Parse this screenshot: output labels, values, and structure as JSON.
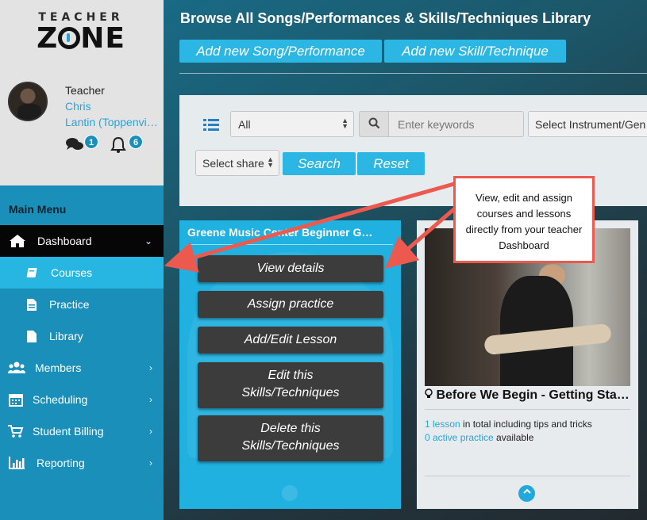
{
  "brand": {
    "logo_top": "TEACHER",
    "logo_main_left": "Z",
    "logo_main_right": "NE"
  },
  "user": {
    "role": "Teacher",
    "first_name": "Chris",
    "last_name": "Lantin (Toppenvi…"
  },
  "notifications": {
    "messages_count": "1",
    "alerts_count": "6"
  },
  "sidebar": {
    "heading": "Main Menu",
    "items": [
      {
        "label": "Dashboard",
        "icon": "home-icon",
        "chevron": "⌄"
      },
      {
        "label": "Courses",
        "icon": "book-icon"
      },
      {
        "label": "Practice",
        "icon": "document-icon"
      },
      {
        "label": "Library",
        "icon": "file-icon"
      },
      {
        "label": "Members",
        "icon": "users-icon",
        "chevron": "›"
      },
      {
        "label": "Scheduling",
        "icon": "calendar-icon",
        "chevron": "›"
      },
      {
        "label": "Student Billing",
        "icon": "cart-icon",
        "chevron": "›"
      },
      {
        "label": "Reporting",
        "icon": "bar-chart-icon",
        "chevron": "›"
      }
    ]
  },
  "header": {
    "title": "Browse All Songs/Performances & Skills/Techniques Library",
    "add_song_label": "Add new Song/Performance",
    "add_skill_label": "Add new Skill/Technique"
  },
  "filters": {
    "type_value": "All",
    "keyword_placeholder": "Enter keywords",
    "instrument_value": "Select Instrument/Gen",
    "share_value": "Select share",
    "search_label": "Search",
    "reset_label": "Reset"
  },
  "card1": {
    "title": "Greene Music Center Beginner G…",
    "actions": {
      "view_details": "View details",
      "assign_practice": "Assign practice",
      "add_edit_lesson": "Add/Edit Lesson",
      "edit_line1": "Edit this",
      "edit_line2": "Skills/Techniques",
      "delete_line1": "Delete this",
      "delete_line2": "Skills/Techniques"
    }
  },
  "card2": {
    "title": "Before We Begin - Getting Sta…",
    "lessons_link": "1 lesson",
    "lessons_text": " in total including tips and tricks",
    "practice_link": "0 active practice",
    "practice_text": " available"
  },
  "callout": {
    "text": "View, edit and assign courses and lessons directly from your teacher Dashboard"
  },
  "colors": {
    "accent": "#2bb6e3",
    "sidebar": "#1a8fb9",
    "callout_border": "#ec5a4f",
    "dark_button": "#3c3c3c"
  }
}
